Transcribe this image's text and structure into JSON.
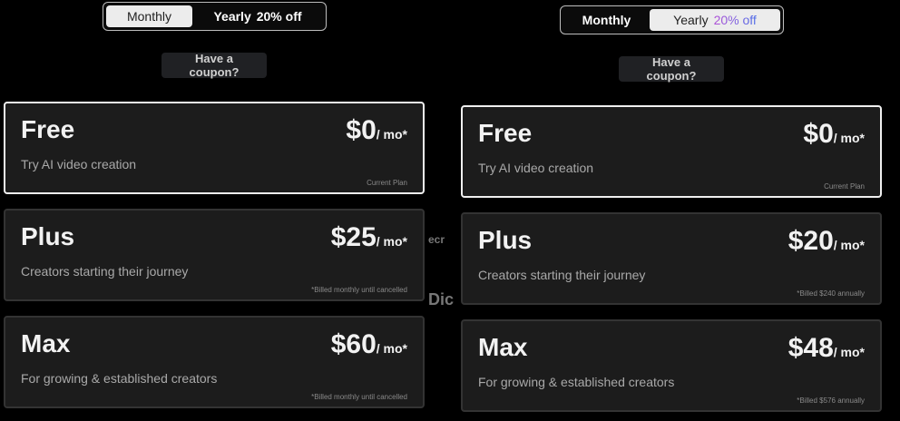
{
  "left": {
    "toggle": {
      "monthly": "Monthly",
      "yearly": "Yearly",
      "discount": "20% off",
      "selected": "Monthly"
    },
    "coupon": "Have a coupon?",
    "plans": [
      {
        "name": "Free",
        "desc": "Try AI video creation",
        "price": "$0",
        "per": "/ mo*",
        "note": "Current Plan",
        "current": true
      },
      {
        "name": "Plus",
        "desc": "Creators starting their journey",
        "price": "$25",
        "per": "/ mo*",
        "note": "*Billed monthly until cancelled",
        "current": false
      },
      {
        "name": "Max",
        "desc": "For growing & established creators",
        "price": "$60",
        "per": "/ mo*",
        "note": "*Billed monthly until cancelled",
        "current": false
      }
    ]
  },
  "right": {
    "toggle": {
      "monthly": "Monthly",
      "yearly": "Yearly",
      "discount": "20% off",
      "selected": "Yearly"
    },
    "coupon": "Have a coupon?",
    "plans": [
      {
        "name": "Free",
        "desc": "Try AI video creation",
        "price": "$0",
        "per": "/ mo*",
        "note": "Current Plan",
        "current": true
      },
      {
        "name": "Plus",
        "desc": "Creators starting their journey",
        "price": "$20",
        "per": "/ mo*",
        "note": "*Billed $240 annually",
        "current": false
      },
      {
        "name": "Max",
        "desc": "For growing & established creators",
        "price": "$48",
        "per": "/ mo*",
        "note": "*Billed $576 annually",
        "current": false
      }
    ]
  },
  "background_fragments": [
    "ecr",
    "Dic"
  ]
}
